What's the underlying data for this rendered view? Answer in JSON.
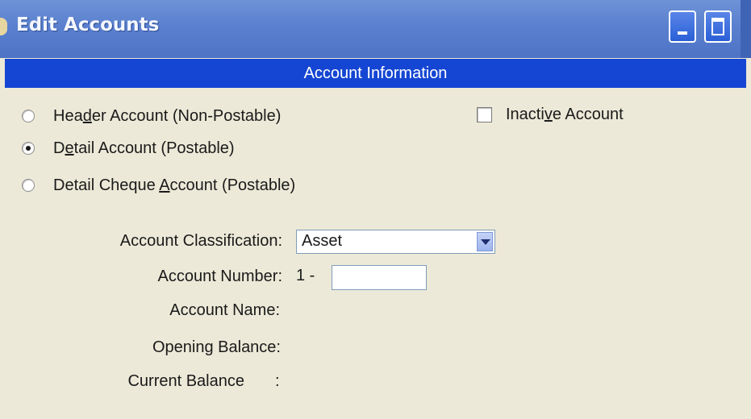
{
  "window": {
    "title": "Edit Accounts"
  },
  "section": {
    "header": "Account Information"
  },
  "account_type": {
    "options": [
      {
        "pre": "Hea",
        "key": "d",
        "post": "er Account (Non-Postable)",
        "selected": false
      },
      {
        "pre": "D",
        "key": "e",
        "post": "tail Account (Postable)",
        "selected": true
      },
      {
        "pre": "Detail Cheque ",
        "key": "A",
        "post": "ccount (Postable)",
        "selected": false
      }
    ]
  },
  "inactive": {
    "pre": "Inacti",
    "key": "v",
    "post": "e Account",
    "checked": false
  },
  "fields": {
    "classification_label": "Account Classification:",
    "classification_value": "Asset",
    "number_label": "Account Number:",
    "number_prefix": "1 -",
    "number_value": "",
    "name_label": "Account Name:",
    "opening_label": "Opening Balance:",
    "current_label": "Current Balance",
    "current_colon": ":"
  },
  "colors": {
    "titlebar": "#5a80cf",
    "section_header": "#1546d3",
    "window_bg": "#ece9d8"
  },
  "icons": {
    "minimize": "minimize-icon",
    "maximize": "maximize-icon",
    "dropdown": "chevron-down-icon"
  }
}
